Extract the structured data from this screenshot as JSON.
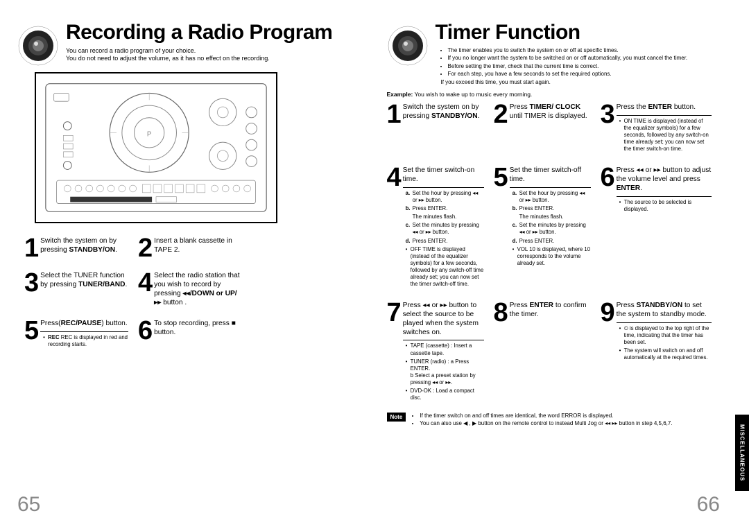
{
  "left": {
    "title": "Recording a Radio Program",
    "subtitle1": "You can record a radio program of your choice.",
    "subtitle2": "You do not need to adjust the volume, as it has no effect on the recording.",
    "steps": {
      "s1": {
        "n": "1",
        "body_pre": "Switch the system on by pressing ",
        "body_b": "STANDBY/ON",
        "body_post": "."
      },
      "s2": {
        "n": "2",
        "body": "Insert a blank cassette in TAPE 2."
      },
      "s3": {
        "n": "3",
        "body_pre": "Select the TUNER function by pressing ",
        "body_b": "TUNER/BAND",
        "body_post": "."
      },
      "s4": {
        "n": "4",
        "body_pre": "Select the radio station that you wish to record by pressing ",
        "body_b": "◂◂/DOWN or UP/▸▸",
        "body_post": " button ."
      },
      "s5": {
        "n": "5",
        "body_pre": "Press(",
        "body_b": "REC/PAUSE",
        "body_post": ") button.",
        "foot1": "REC is displayed in red and recording starts."
      },
      "s6": {
        "n": "6",
        "body_pre": "To stop recording, press ",
        "body_b": "■",
        "body_post": " button."
      }
    },
    "pagenum": "65"
  },
  "right": {
    "title": "Timer Function",
    "bullets": {
      "b1": "The timer enables you to switch the system on or off at specific times.",
      "b2": "If you no longer want the system to be switched on or off automatically, you must cancel the timer.",
      "b3": "Before setting the timer, check that the current time is correct.",
      "b4a": "For each step, you have a few seconds to set the required options.",
      "b4b": "If you exceed this time, you must start again."
    },
    "example_label": "Example:",
    "example_text": "You wish to wake up to music every morning.",
    "steps": {
      "s1": {
        "n": "1",
        "body_pre": "Switch the system on by pressing ",
        "body_b": "STANDBY/ON",
        "body_post": "."
      },
      "s2": {
        "n": "2",
        "body_pre": "Press ",
        "body_b": "TIMER/ CLOCK",
        "body_post": " until TIMER is displayed."
      },
      "s3": {
        "n": "3",
        "body_pre": "Press the ",
        "body_b": "ENTER",
        "body_post": " button.",
        "foot1": "ON TIME is displayed (instead of the equalizer symbols) for a few seconds, followed by any switch-on time already set; you can now set the timer switch-on time."
      },
      "s4": {
        "n": "4",
        "body": "Set the timer switch-on time.",
        "fa": "Set the hour by pressing ◂◂ or ▸▸ button.",
        "fb": "Press ENTER.",
        "fb_sub": "The minutes flash.",
        "fc": "Set the minutes by pressing ◂◂ or ▸▸ button.",
        "fd": "Press ENTER.",
        "foot_bullet": "OFF TIME is displayed (instead of the equalizer symbols) for a few seconds, followed by any switch-off time already set; you can now set the timer switch-off time."
      },
      "s5": {
        "n": "5",
        "body": "Set the timer switch-off time.",
        "fa": "Set the hour by pressing ◂◂ or ▸▸ button.",
        "fb": "Press ENTER.",
        "fb_sub": "The minutes flash.",
        "fc": "Set the minutes by pressing ◂◂ or ▸▸ button.",
        "fd": "Press ENTER.",
        "foot_bullet": "VOL 10 is displayed, where 10 corresponds to the volume already set."
      },
      "s6": {
        "n": "6",
        "body_pre": "Press ◂◂ or ▸▸ button to adjust the volume level and press ",
        "body_b": "ENTER",
        "body_post": ".",
        "foot1": "The source to be selected is displayed."
      },
      "s7": {
        "n": "7",
        "body": "Press ◂◂ or ▸▸ button to select the source to be played when the system switches on.",
        "foot1": "TAPE (cassette) : Insert a cassette tape.",
        "foot2a": "TUNER (radio) : a Press ENTER.",
        "foot2b": "b Select a preset station by pressing ◂◂ or ▸▸.",
        "foot3": "DVD-OK : Load a compact disc."
      },
      "s8": {
        "n": "8",
        "body_pre": "Press ",
        "body_b": "ENTER",
        "body_post": " to confirm the timer."
      },
      "s9": {
        "n": "9",
        "body_pre": "Press ",
        "body_b": "STANDBY/ON",
        "body_post": " to set the system to standby mode.",
        "foot1": "⏲ is displayed to the top right of the time, indicating that the timer has been set.",
        "foot2": "The system will switch on and off automatically at the required times."
      }
    },
    "note_label": "Note",
    "note1": "If the timer switch on and off times are identical, the word ERROR is displayed.",
    "note2": "You can also use ◀ , ▶ button on the remote control to instead Multi Jog or ◂◂ ▸▸ button in step 4,5,6,7.",
    "misc": "MISCELLANEOUS",
    "pagenum": "66"
  }
}
